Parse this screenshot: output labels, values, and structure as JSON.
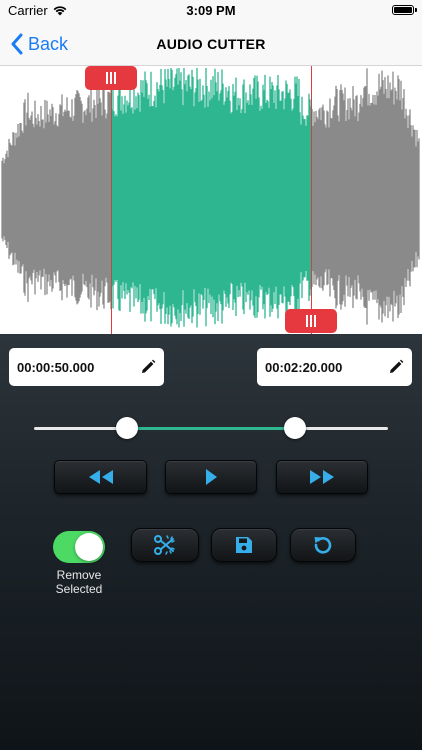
{
  "status_bar": {
    "carrier": "Carrier",
    "time": "3:09 PM"
  },
  "nav": {
    "back_label": "Back",
    "title": "AUDIO CUTTER"
  },
  "selection": {
    "start_fraction": 0.263,
    "end_fraction": 0.737
  },
  "start_time": {
    "value": "00:00:50.000"
  },
  "end_time": {
    "value": "00:02:20.000"
  },
  "playback": {
    "buttons": [
      "rewind",
      "play",
      "fast-forward"
    ]
  },
  "remove_selected": {
    "label": "Remove\nSelected",
    "on": true
  },
  "actions": [
    "cut",
    "save",
    "reset"
  ],
  "colors": {
    "accent": "#2fb791",
    "marker": "#e5393f",
    "link": "#1a7cf5",
    "icon": "#35aeea",
    "toggle_on": "#4cd964",
    "wave_unselected": "#8a8a8a"
  }
}
